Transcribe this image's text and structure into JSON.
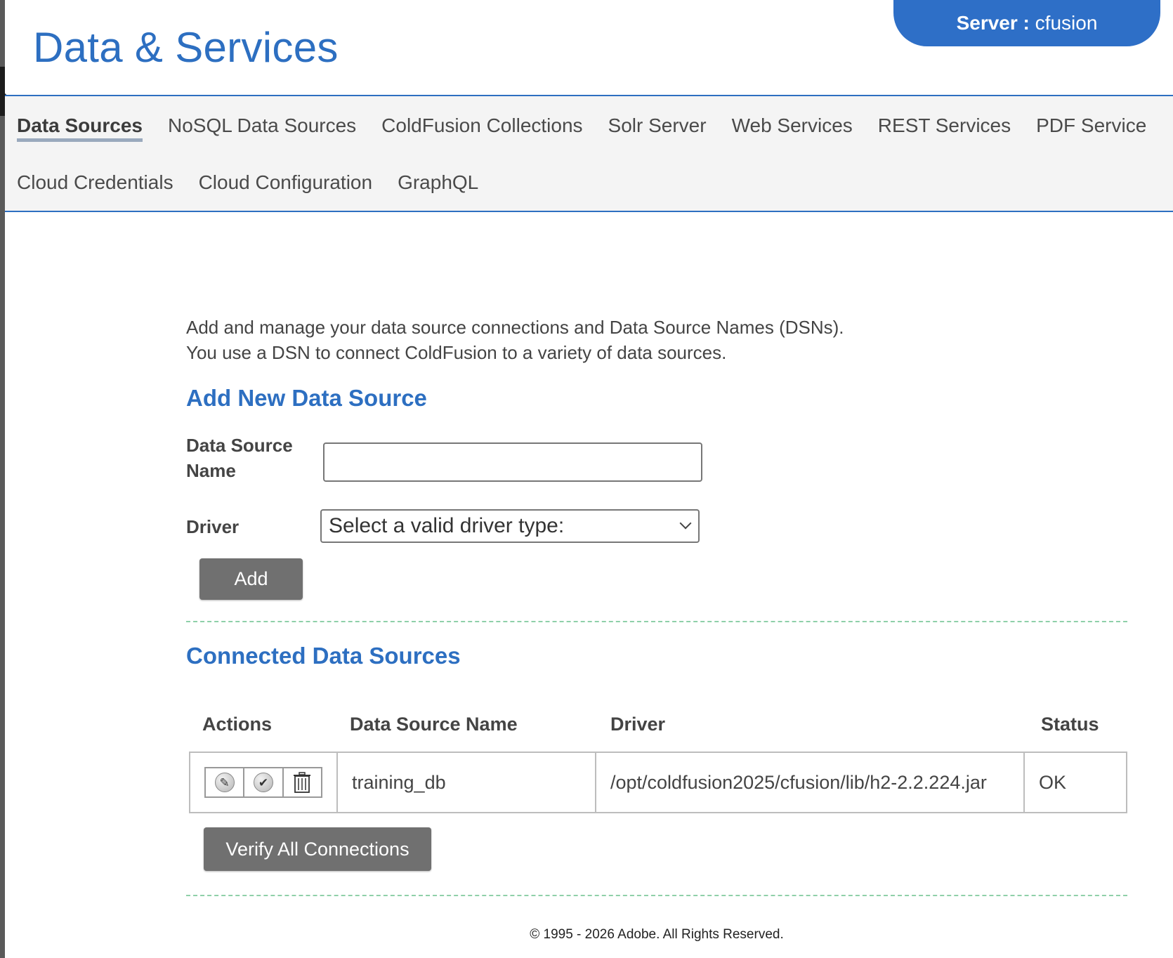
{
  "header": {
    "title": "Data & Services",
    "server_label": "Server :",
    "server_name": "cfusion",
    "accent_color": "#2d6fc1"
  },
  "nav": {
    "row1": [
      "Data Sources",
      "NoSQL Data Sources",
      "ColdFusion Collections",
      "Solr Server",
      "Web Services",
      "REST Services",
      "PDF Service"
    ],
    "row2": [
      "Cloud Credentials",
      "Cloud Configuration",
      "GraphQL"
    ],
    "active": "Data Sources"
  },
  "intro": {
    "line1": "Add and manage your data source connections and Data Source Names (DSNs).",
    "line2": "You use a DSN to connect ColdFusion to a variety of data sources."
  },
  "add_form": {
    "title": "Add New Data Source",
    "dsn_label_line1": "Data Source",
    "dsn_label_line2": "Name",
    "dsn_value": "",
    "driver_label": "Driver",
    "driver_selected": "Select a valid driver type:",
    "add_button": "Add"
  },
  "connected": {
    "title": "Connected Data Sources",
    "columns": [
      "Actions",
      "Data Source Name",
      "Driver",
      "Status"
    ],
    "rows": [
      {
        "icons": [
          "edit-icon",
          "verify-icon",
          "trash-icon"
        ],
        "name": "training_db",
        "driver": "/opt/coldfusion2025/cfusion/lib/h2-2.2.224.jar",
        "status": "OK"
      }
    ],
    "verify_button": "Verify All Connections"
  },
  "footer": {
    "copyright": "© 1995 - 2026 Adobe. All Rights Reserved."
  }
}
